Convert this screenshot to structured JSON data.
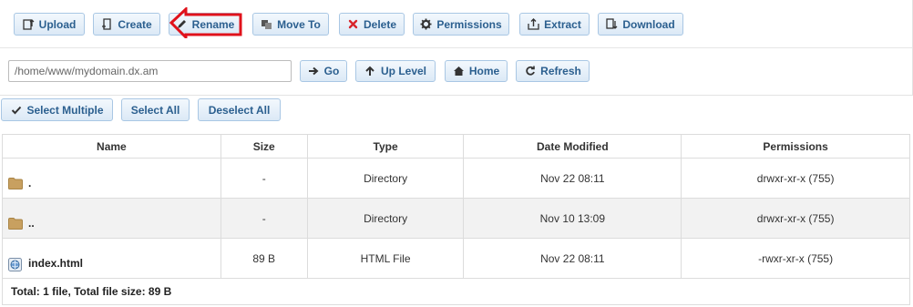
{
  "toolbar": {
    "upload": "Upload",
    "create": "Create",
    "rename": "Rename",
    "move_to": "Move To",
    "delete": "Delete",
    "permissions": "Permissions",
    "extract": "Extract",
    "download": "Download"
  },
  "nav": {
    "path_value": "/home/www/mydomain.dx.am",
    "go": "Go",
    "up_level": "Up Level",
    "home": "Home",
    "refresh": "Refresh"
  },
  "selection": {
    "select_multiple": "Select Multiple",
    "select_all": "Select All",
    "deselect_all": "Deselect All"
  },
  "table": {
    "headers": [
      "Name",
      "Size",
      "Type",
      "Date Modified",
      "Permissions"
    ],
    "rows": [
      {
        "icon": "folder-icon",
        "name": ".",
        "size": "-",
        "type": "Directory",
        "date": "Nov 22 08:11",
        "perms": "drwxr-xr-x (755)"
      },
      {
        "icon": "folder-icon",
        "name": "..",
        "size": "-",
        "type": "Directory",
        "date": "Nov 10 13:09",
        "perms": "drwxr-xr-x (755)"
      },
      {
        "icon": "html-file-icon",
        "name": "index.html",
        "size": "89 B",
        "type": "HTML File",
        "date": "Nov 22 08:11",
        "perms": "-rwxr-xr-x (755)"
      }
    ],
    "summary": "Total: 1 file, Total file size: 89 B"
  },
  "colors": {
    "button_text": "#2b5f8f",
    "button_border": "#a9c7e4",
    "annotation_arrow": "#e0121b",
    "delete_icon": "#d8252b",
    "folder": "#c8a060"
  }
}
